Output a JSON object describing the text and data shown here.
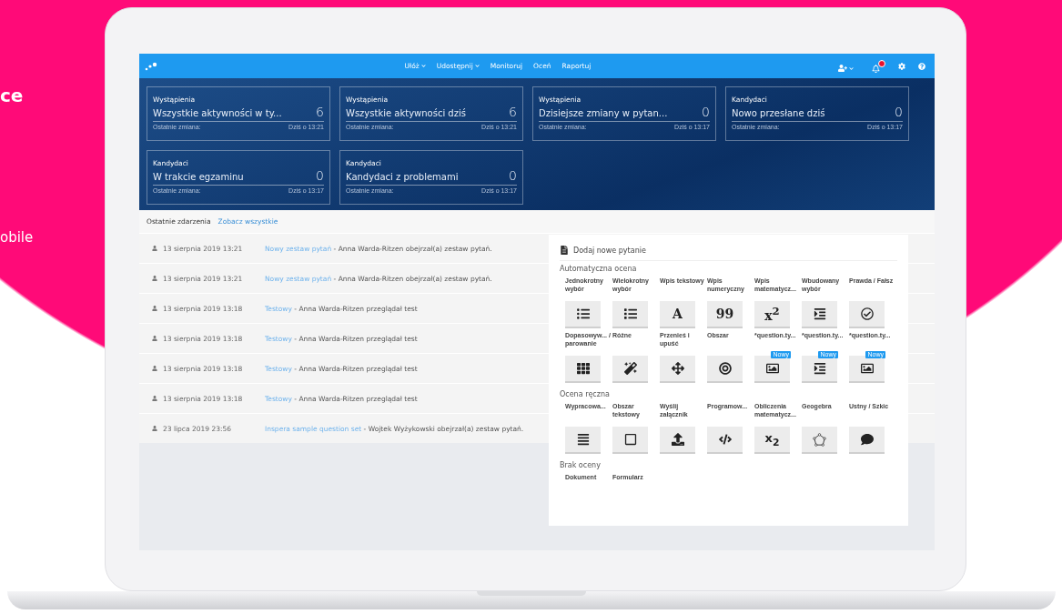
{
  "backdrop": {
    "texts": [
      "ce",
      "obile"
    ]
  },
  "nav": {
    "menu": [
      {
        "label": "Ułóż",
        "dropdown": true
      },
      {
        "label": "Udostępnij",
        "dropdown": true
      },
      {
        "label": "Monitoruj",
        "dropdown": false
      },
      {
        "label": "Oceń",
        "dropdown": false
      },
      {
        "label": "Raportuj",
        "dropdown": false
      }
    ],
    "notification_badge": true
  },
  "cards": [
    {
      "category": "Wystąpienia",
      "title": "Wszystkie aktywności w ty...",
      "count": "6",
      "footer_label": "Ostatnie zmiana:",
      "footer_time": "Dziś o 13:21"
    },
    {
      "category": "Wystąpienia",
      "title": "Wszystkie aktywności dziś",
      "count": "6",
      "footer_label": "Ostatnie zmiana:",
      "footer_time": "Dziś o 13:21"
    },
    {
      "category": "Wystąpienia",
      "title": "Dzisiejsze zmiany w pytan...",
      "count": "0",
      "footer_label": "Ostatnie zmiana:",
      "footer_time": "Dziś o 13:17"
    },
    {
      "category": "Kandydaci",
      "title": "Nowo przesłane dziś",
      "count": "0",
      "footer_label": "Ostatnie zmiana:",
      "footer_time": "Dziś o 13:17"
    },
    {
      "category": "Kandydaci",
      "title": "W trakcie egzaminu",
      "count": "0",
      "footer_label": "Ostatnie zmiana:",
      "footer_time": "Dziś o 13:17"
    },
    {
      "category": "Kandydaci",
      "title": "Kandydaci z problemami",
      "count": "0",
      "footer_label": "Ostatnie zmiana:",
      "footer_time": "Dziś o 13:17"
    }
  ],
  "events": {
    "title": "Ostatnie zdarzenia",
    "link": "Zobacz wszystkie",
    "rows": [
      {
        "date": "13 sierpnia 2019 13:21",
        "link": "Nowy zestaw pytań",
        "text": "- Anna Warda-Ritzen obejrzał(a) zestaw pytań."
      },
      {
        "date": "13 sierpnia 2019 13:21",
        "link": "Nowy zestaw pytań",
        "text": "- Anna Warda-Ritzen obejrzał(a) zestaw pytań."
      },
      {
        "date": "13 sierpnia 2019 13:18",
        "link": "Testowy",
        "text": "- Anna Warda-Ritzen przeglądał test"
      },
      {
        "date": "13 sierpnia 2019 13:18",
        "link": "Testowy",
        "text": "- Anna Warda-Ritzen przeglądał test"
      },
      {
        "date": "13 sierpnia 2019 13:18",
        "link": "Testowy",
        "text": "- Anna Warda-Ritzen przeglądał test"
      },
      {
        "date": "13 sierpnia 2019 13:18",
        "link": "Testowy",
        "text": "- Anna Warda-Ritzen przeglądał test"
      },
      {
        "date": "23 lipca 2019 23:56",
        "link": "Inspera sample question set",
        "text": "- Wojtek Wyżykowski obejrzał(a) zestaw pytań."
      }
    ]
  },
  "panel": {
    "title": "Dodaj nowe pytanie",
    "sections": [
      {
        "title": "Automatyczna ocena",
        "items": [
          {
            "label": "Jednokrotny wybór",
            "kind": "list"
          },
          {
            "label": "Wielokrotny wybór",
            "kind": "rows"
          },
          {
            "label": "Wpis tekstowy",
            "kind": "serif",
            "glyph": "A"
          },
          {
            "label": "Wpis numeryczny",
            "kind": "serif",
            "glyph": "99"
          },
          {
            "label": "Wpis matematycz...",
            "kind": "serif",
            "glyph": "x$^{2}$"
          },
          {
            "label": "Wbudowany wybór",
            "kind": "indent"
          },
          {
            "label": "Prawda / Fałsz",
            "kind": "check"
          },
          {
            "label": "Dopasowyw... / parowanie",
            "kind": "grid"
          },
          {
            "label": "Różne",
            "kind": "wand"
          },
          {
            "label": "Przenieś i upuść",
            "kind": "move"
          },
          {
            "label": "Obszar",
            "kind": "target"
          },
          {
            "label": "*question.ty...",
            "kind": "image",
            "badge": "Nowy"
          },
          {
            "label": "*question.ty...",
            "kind": "indent",
            "badge": "Nowy"
          },
          {
            "label": "*question.ty...",
            "kind": "image",
            "badge": "Nowy"
          }
        ]
      },
      {
        "title": "Ocena ręczna",
        "items": [
          {
            "label": "Wypracowa...",
            "kind": "lines"
          },
          {
            "label": "Obszar tekstowy",
            "kind": "square"
          },
          {
            "label": "Wyślij załącznik",
            "kind": "upload"
          },
          {
            "label": "Programow...",
            "kind": "code"
          },
          {
            "label": "Obliczenia matematycz...",
            "kind": "sans",
            "glyph": "x$_{2}$"
          },
          {
            "label": "Geogebra",
            "kind": "polygon"
          },
          {
            "label": "Ustny / Szkic",
            "kind": "comment"
          }
        ]
      },
      {
        "title": "Brak oceny",
        "items": [
          {
            "label": "Dokument",
            "kind": "plain"
          },
          {
            "label": "Formularz",
            "kind": "plain"
          }
        ]
      }
    ]
  }
}
